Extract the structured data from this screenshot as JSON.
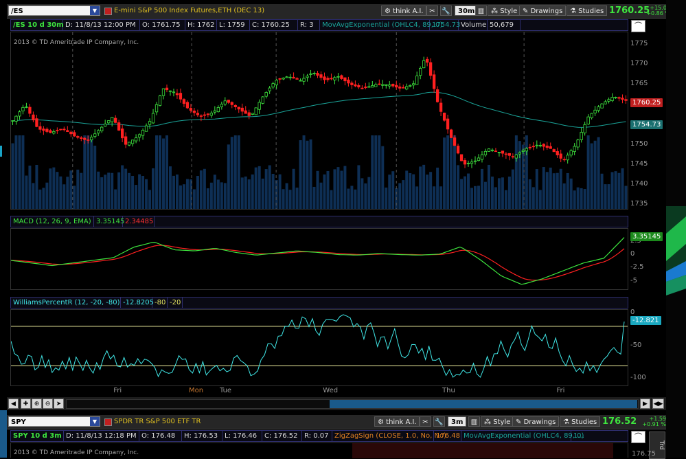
{
  "top": {
    "symbol": "/ES",
    "description": "E-mini S&P 500 Index Futures,ETH (DEC 13)",
    "buttons": {
      "think_ai": "think A.I.",
      "aggregation": "30m",
      "style": "Style",
      "drawings": "Drawings",
      "studies": "Studies"
    },
    "last_price": "1760.25",
    "change": "+15.00",
    "change_pct": "+0.86 %",
    "info": {
      "title": "/ES 10 d 30m",
      "date": "D: 11/8/13 12:00 PM",
      "open": "O: 1761.75",
      "high": "H: 1762",
      "low": "L: 1759",
      "close": "C: 1760.25",
      "range": "R: 3",
      "ma_label": "MovAvgExponential (OHLC4, 89, 0)",
      "ma_value": "1754.73",
      "volume_label": "Volume",
      "volume_value": "50,679"
    },
    "copyright": "2013 © TD Ameritrade IP Company, Inc.",
    "yaxis": [
      "1775",
      "1770",
      "1765",
      "1760",
      "1755",
      "1750",
      "1745",
      "1740",
      "1735"
    ],
    "price_tag": "1760.25",
    "ma_tag": "1754.73",
    "macd": {
      "label": "MACD (12, 26, 9, EMA)",
      "value": "3.35145",
      "avg": "2.34485",
      "tag": "3.35145",
      "yaxis": [
        "2.5",
        "0",
        "-2.5",
        "-5"
      ]
    },
    "willr": {
      "label": "WilliamsPercentR (12, -20, -80)",
      "value": "-12.8205",
      "over_bought": "-80",
      "over_sold": "-20",
      "tag": "-12.821",
      "yaxis": [
        "0",
        "-50",
        "-100"
      ]
    },
    "days": [
      "Fri",
      "Mon",
      "Tue",
      "Wed",
      "Thu",
      "Fri"
    ]
  },
  "bottom": {
    "symbol": "SPY",
    "description": "SPDR TR S&P 500 ETF TR",
    "buttons": {
      "think_ai": "think A.I.",
      "aggregation": "3m",
      "style": "Style",
      "drawings": "Drawings",
      "studies": "Studies"
    },
    "last_price": "176.52",
    "change": "+1.59",
    "change_pct": "+0.91 %",
    "info": {
      "title": "SPY 10 d 3m",
      "date": "D: 11/8/13 12:18 PM",
      "open": "O: 176.48",
      "high": "H: 176.53",
      "low": "L: 176.46",
      "close": "C: 176.52",
      "range": "R: 0.07",
      "zz_label": "ZigZagSign (CLOSE, 1.0, No, No)",
      "zz_value": "176.48",
      "ma_label": "MovAvgExponential (OHLC4, 89, 0)",
      "ma_value": "1..."
    },
    "copyright": "2013 © TD Ameritrade IP Company, Inc.",
    "yaxis_top": "176.75"
  },
  "colors": {
    "up": "#3ee63e",
    "down": "#ff2020",
    "ma": "#1aa59a",
    "volume": "#0e2f55",
    "macd": "#3ee63e",
    "macd_avg": "#ff2020",
    "willr": "#40e8e8",
    "price_tag": "#c02020",
    "ma_tag": "#1a7070"
  }
}
